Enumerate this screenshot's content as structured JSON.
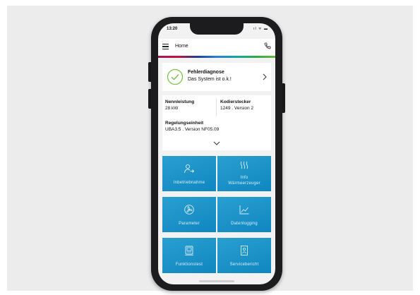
{
  "status_bar": {
    "time": "13:20",
    "icons": "ıl ᯤ ▬"
  },
  "appbar": {
    "title": "Home"
  },
  "diagnosis": {
    "title": "Fehlerdiagnose",
    "status": "Das System ist o.k.!"
  },
  "info": {
    "rated_power_label": "Nennleistung",
    "rated_power_value": "28 kW",
    "coding_plug_label": "Kodierstecker",
    "coding_plug_value": "1249 . Version 2",
    "control_unit_label": "Regelungseinheit",
    "control_unit_value": "UBA3.5 . Version NF05.09"
  },
  "tiles": [
    {
      "label": "Inbetriebnahme",
      "icon": "person-arrow-icon"
    },
    {
      "label_line1": "Info",
      "label_line2": "Wärmeerzeuger",
      "icon": "heat-waves-icon"
    },
    {
      "label": "Parameter",
      "icon": "fan-icon"
    },
    {
      "label": "Datenlogging",
      "icon": "line-chart-icon"
    },
    {
      "label": "Funktionstest",
      "icon": "test-device-icon"
    },
    {
      "label": "Servicebericht",
      "icon": "report-icon"
    }
  ],
  "colors": {
    "tile": "#1a93c9",
    "check": "#7cc04a",
    "background": "#ececec"
  }
}
